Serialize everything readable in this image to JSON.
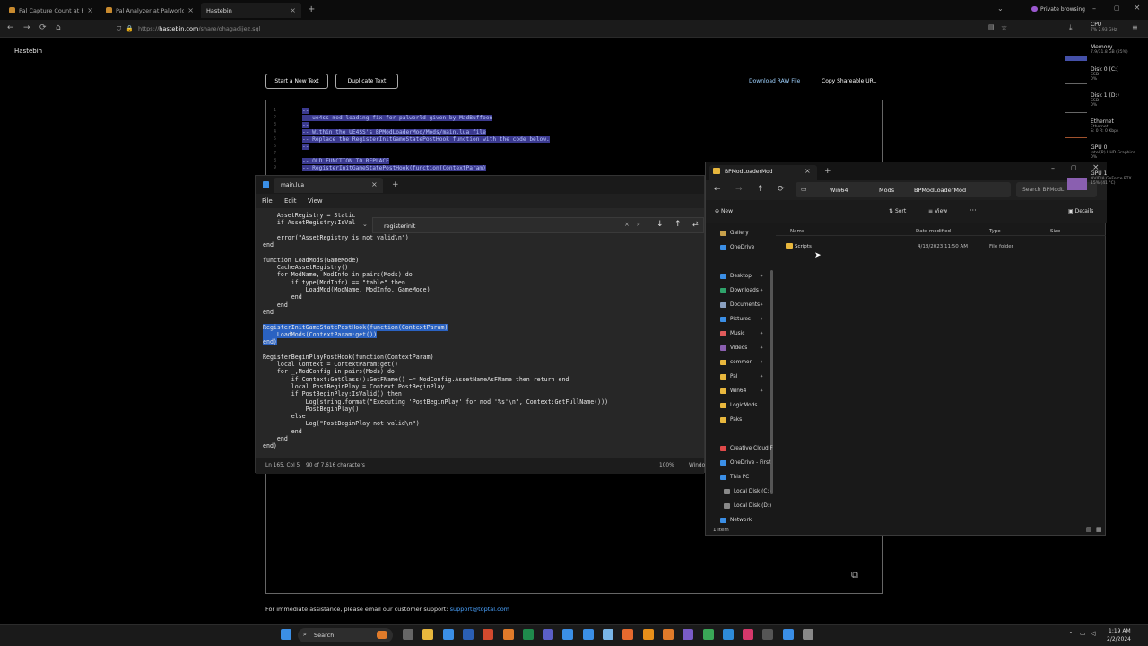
{
  "browser": {
    "tabs": [
      {
        "label": "Pal Capture Count at Palworld G"
      },
      {
        "label": "Pal Analyzer at Palworld Nexus"
      },
      {
        "label": "Hastebin"
      }
    ],
    "private_label": "Private browsing",
    "url_prefix": "https://",
    "url_domain": "hastebin.com",
    "url_path": "/share/ohagadijez.sql"
  },
  "page": {
    "site_title": "Hastebin",
    "new_text_button": "Start a New Text",
    "duplicate_button": "Duplicate Text",
    "download_link": "Download RAW File",
    "copy_link": "Copy Shareable URL",
    "code_lines": [
      {
        "n": "1",
        "t": "--"
      },
      {
        "n": "2",
        "t": "-- ue4ss mod loading fix for palworld given by MadBuffoon"
      },
      {
        "n": "3",
        "t": "--"
      },
      {
        "n": "4",
        "t": "-- Within the UE4SS's BPModLoaderMod/Mods/main.lua file"
      },
      {
        "n": "5",
        "t": "-- Replace the RegisterInitGameStatePostHook function with the code below."
      },
      {
        "n": "6",
        "t": "--"
      },
      {
        "n": "7",
        "t": ""
      },
      {
        "n": "8",
        "t": "-- OLD FUNCTION TO REPLACE"
      },
      {
        "n": "9",
        "t": "-- RegisterInitGameStatePostHook(function(ContextParam)"
      }
    ],
    "footer_text": "For immediate assistance, please email our customer support: ",
    "footer_email": "support@toptal.com"
  },
  "notepad": {
    "tab_title": "main.lua",
    "menu": [
      "File",
      "Edit",
      "View"
    ],
    "find_value": "registerinit",
    "code": [
      {
        "t": "    AssetRegistry = Static",
        "hl": false
      },
      {
        "t": "    if AssetRegistry:IsVal",
        "hl": false
      },
      {
        "t": "",
        "hl": false
      },
      {
        "t": "    error(\"AssetRegistry is not valid\\n\")",
        "hl": false
      },
      {
        "t": "end",
        "hl": false
      },
      {
        "t": "",
        "hl": false
      },
      {
        "t": "function LoadMods(GameMode)",
        "hl": false
      },
      {
        "t": "    CacheAssetRegistry()",
        "hl": false
      },
      {
        "t": "    for ModName, ModInfo in pairs(Mods) do",
        "hl": false
      },
      {
        "t": "        if type(ModInfo) == \"table\" then",
        "hl": false
      },
      {
        "t": "            LoadMod(ModName, ModInfo, GameMode)",
        "hl": false
      },
      {
        "t": "        end",
        "hl": false
      },
      {
        "t": "    end",
        "hl": false
      },
      {
        "t": "end",
        "hl": false
      },
      {
        "t": "",
        "hl": false
      },
      {
        "t": "RegisterInitGameStatePostHook(function(ContextParam)",
        "hl": true
      },
      {
        "t": "    LoadMods(ContextParam:get())",
        "hl": true
      },
      {
        "t": "end)",
        "hl": true
      },
      {
        "t": "",
        "hl": false
      },
      {
        "t": "RegisterBeginPlayPostHook(function(ContextParam)",
        "hl": false
      },
      {
        "t": "    local Context = ContextParam:get()",
        "hl": false
      },
      {
        "t": "    for _,ModConfig in pairs(Mods) do",
        "hl": false
      },
      {
        "t": "        if Context:GetClass():GetFName() ~= ModConfig.AssetNameAsFName then return end",
        "hl": false
      },
      {
        "t": "        local PostBeginPlay = Context.PostBeginPlay",
        "hl": false
      },
      {
        "t": "        if PostBeginPlay:IsValid() then",
        "hl": false
      },
      {
        "t": "            Log(string.format(\"Executing 'PostBeginPlay' for mod '%s'\\n\", Context:GetFullName()))",
        "hl": false
      },
      {
        "t": "            PostBeginPlay()",
        "hl": false
      },
      {
        "t": "        else",
        "hl": false
      },
      {
        "t": "            Log(\"PostBeginPlay not valid\\n\")",
        "hl": false
      },
      {
        "t": "        end",
        "hl": false
      },
      {
        "t": "    end",
        "hl": false
      },
      {
        "t": "end)",
        "hl": false
      }
    ],
    "status_pos": "Ln 165, Col 5",
    "status_chars": "90 of 7,616 characters",
    "status_zoom": "100%",
    "status_eol": "Windo"
  },
  "explorer": {
    "tab_title": "BPModLoaderMod",
    "breadcrumb": [
      "Win64",
      "Mods",
      "BPModLoaderMod"
    ],
    "search_placeholder": "Search BPModL",
    "toolbar": {
      "new": "New",
      "sort": "Sort",
      "view": "View",
      "details": "Details"
    },
    "columns": [
      "Name",
      "Date modified",
      "Type",
      "Size"
    ],
    "files": [
      {
        "name": "Scripts",
        "date": "4/18/2023 11:50 AM",
        "type": "File folder",
        "size": ""
      }
    ],
    "sidebar_top": [
      "Gallery",
      "OneDrive"
    ],
    "quick_access": [
      "Desktop",
      "Downloads",
      "Documents",
      "Pictures",
      "Music",
      "Videos",
      "common",
      "Pal",
      "Win64",
      "LogicMods",
      "Paks"
    ],
    "sidebar_bottom": [
      "Creative Cloud F",
      "OneDrive - First",
      "This PC",
      "Local Disk (C:)",
      "Local Disk (D:)",
      "Network"
    ],
    "status": "1 item"
  },
  "perf": {
    "cpu": "CPU",
    "cpu_sub": "7% 2.93 GHz",
    "memory": "Memory",
    "memory_sub": "7.9/31.8 GB (25%)",
    "disk0": "Disk 0 (C:)",
    "disk0_sub1": "SSD",
    "disk0_sub2": "0%",
    "disk1": "Disk 1 (D:)",
    "disk1_sub1": "SSD",
    "disk1_sub2": "0%",
    "ethernet": "Ethernet",
    "ethernet_sub1": "Ethernet",
    "ethernet_sub2": "S: 0 R: 0 Kbps",
    "gpu0": "GPU 0",
    "gpu0_sub1": "Intel(R) UHD Graphics ...",
    "gpu0_sub2": "0%",
    "gpu1": "GPU 1",
    "gpu1_sub1": "NVIDIA GeForce RTX ...",
    "gpu1_sub2": "15% (41 °C)"
  },
  "taskbar": {
    "search": "Search",
    "time": "1:19 AM",
    "date": "2/2/2024"
  }
}
